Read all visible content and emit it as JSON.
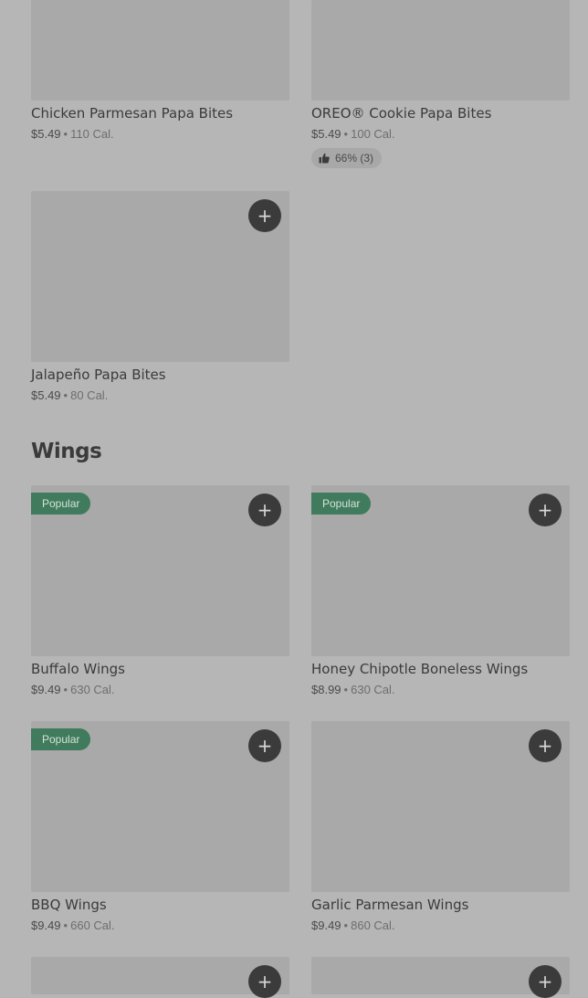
{
  "top_items": [
    {
      "name": "Chicken Parmesan Papa Bites",
      "price": "$5.49",
      "calories": "110 Cal."
    },
    {
      "name": "OREO® Cookie Papa Bites",
      "price": "$5.49",
      "calories": "100 Cal.",
      "rating": "66% (3)"
    },
    {
      "name": "Jalapeño Papa Bites",
      "price": "$5.49",
      "calories": "80 Cal."
    }
  ],
  "wings": {
    "title": "Wings",
    "items": [
      {
        "name": "Buffalo Wings",
        "price": "$9.49",
        "calories": "630 Cal.",
        "badge": "Popular"
      },
      {
        "name": "Honey Chipotle Boneless Wings",
        "price": "$8.99",
        "calories": "630 Cal.",
        "badge": "Popular"
      },
      {
        "name": "BBQ Wings",
        "price": "$9.49",
        "calories": "660 Cal.",
        "badge": "Popular"
      },
      {
        "name": "Garlic Parmesan Wings",
        "price": "$9.49",
        "calories": "860 Cal."
      }
    ]
  },
  "icons": {
    "add": "plus-icon",
    "rating": "thumbs-up-icon"
  },
  "colors": {
    "background": "#b6b6b6",
    "image_placeholder": "#a9a9a9",
    "add_button": "#3b3b3b",
    "popular_badge": "#3f7b5c"
  }
}
